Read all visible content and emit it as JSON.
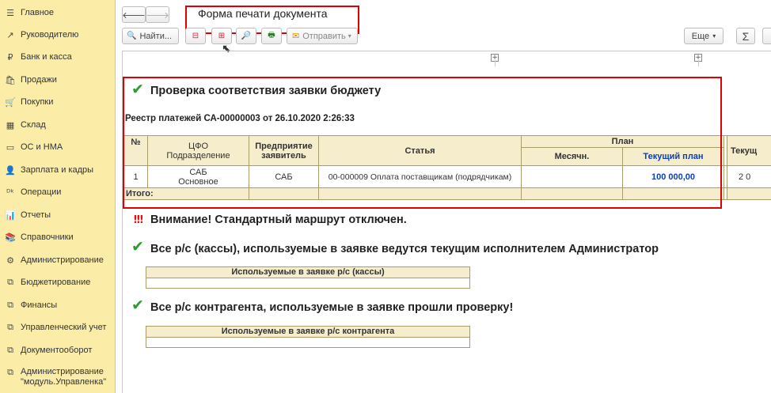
{
  "sidebar": {
    "items": [
      {
        "icon": "☰",
        "label": "Главное"
      },
      {
        "icon": "↗",
        "label": "Руководителю"
      },
      {
        "icon": "₽",
        "label": "Банк и касса"
      },
      {
        "icon": "🛍",
        "label": "Продажи"
      },
      {
        "icon": "🛒",
        "label": "Покупки"
      },
      {
        "icon": "▦",
        "label": "Склад"
      },
      {
        "icon": "▭",
        "label": "ОС и НМА"
      },
      {
        "icon": "👤",
        "label": "Зарплата и кадры"
      },
      {
        "icon": "ᴰᵏ",
        "label": "Операции"
      },
      {
        "icon": "📊",
        "label": "Отчеты"
      },
      {
        "icon": "📚",
        "label": "Справочники"
      },
      {
        "icon": "⚙",
        "label": "Администрирование"
      },
      {
        "icon": "⧉",
        "label": "Бюджетирование"
      },
      {
        "icon": "⧉",
        "label": "Финансы"
      },
      {
        "icon": "⧉",
        "label": "Управленческий учет"
      },
      {
        "icon": "⧉",
        "label": "Документооборот"
      },
      {
        "icon": "⧉",
        "label": "Администрирование \"модуль.Управленка\""
      }
    ]
  },
  "toolbar": {
    "title": "Форма печати документа",
    "find_label": "Найти...",
    "send_label": "Отправить",
    "more_label": "Еще",
    "sum_label": "Σ"
  },
  "report": {
    "title1": "Проверка соответствия заявки бюджету",
    "registry": "Реестр платежей СА-00000003 от 26.10.2020 2:26:33",
    "headers": {
      "num": "№",
      "cfo": "ЦФО\nПодразделение",
      "enterprise": "Предприятие заявитель",
      "article": "Статья",
      "plan": "План",
      "monthly": "Месячн.",
      "current_plan": "Текущий план",
      "current": "Текущ"
    },
    "row": {
      "num": "1",
      "cfo": "САБ\nОсновное",
      "enterprise": "САБ",
      "article": "00-000009 Оплата поставщикам (подрядчикам)",
      "monthly": "",
      "current_plan": "100 000,00",
      "current": "2 0"
    },
    "total_label": "Итого:",
    "warning_icon": "!!!",
    "warning": "Внимание! Стандартный маршрут отключен.",
    "check2": "Все р/с (кассы), используемые в заявке ведутся текущим исполнителем Администратор",
    "table2_header": "Используемые в заявке р/с (кассы)",
    "check3": "Все р/с контрагента, используемые в заявке прошли проверку!",
    "table3_header": "Используемые в заявке р/с контрагента"
  },
  "colors": {
    "sidebar_bg": "#fbeca7",
    "highlight_red": "#e00000",
    "check_green": "#2a9d2a",
    "plan_blue": "#0b3fb5"
  }
}
